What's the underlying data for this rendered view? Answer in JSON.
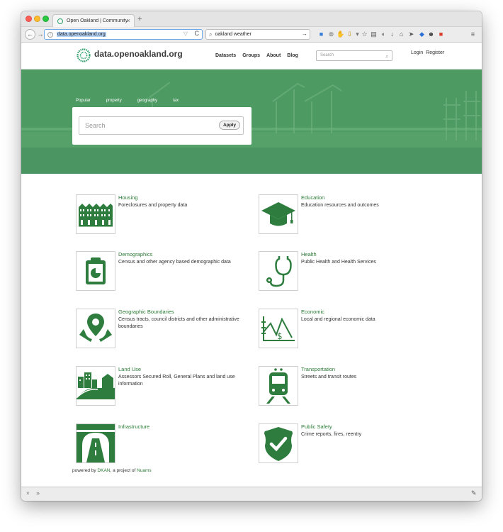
{
  "browser": {
    "tab_title": "Open Oakland | Community...",
    "tab_close": "×",
    "new_tab": "+",
    "back": "←",
    "forward": "→",
    "url": "data.openoakland.org",
    "info": "i",
    "url_dropdown": "▽",
    "reload": "C",
    "search_value": "oakland weather",
    "search_go": "→",
    "toolbar_icons": [
      {
        "name": "container-icon",
        "glyph": "■",
        "color": "#3a7cd6"
      },
      {
        "name": "extension-icon",
        "glyph": "⊜",
        "color": "#666666"
      },
      {
        "name": "hand-icon",
        "glyph": "✋",
        "color": "#3a7cd6"
      },
      {
        "name": "download-arrow-icon",
        "glyph": "⇩",
        "color": "#c08a00"
      },
      {
        "name": "dropdown-icon",
        "glyph": "▾",
        "color": "#777777"
      },
      {
        "name": "bookmark-star-icon",
        "glyph": "☆",
        "color": "#555555"
      },
      {
        "name": "clipboard-icon",
        "glyph": "▤",
        "color": "#555555"
      },
      {
        "name": "pocket-icon",
        "glyph": "◖",
        "color": "#555555"
      },
      {
        "name": "downloads-icon",
        "glyph": "↓",
        "color": "#555555"
      },
      {
        "name": "home-icon",
        "glyph": "⌂",
        "color": "#555555"
      },
      {
        "name": "send-icon",
        "glyph": "➤",
        "color": "#555555"
      },
      {
        "name": "drop-icon",
        "glyph": "◆",
        "color": "#2a6fd6"
      },
      {
        "name": "face-icon",
        "glyph": "☻",
        "color": "#444444"
      },
      {
        "name": "red-extension-icon",
        "glyph": "■",
        "color": "#d93a2b"
      },
      {
        "name": "menu-icon",
        "glyph": "≡",
        "color": "#444444"
      }
    ],
    "status_close": "×",
    "status_more": "»",
    "status_wrench": "✎"
  },
  "site": {
    "logo_text": "data.openoakland.org",
    "nav": [
      "Datasets",
      "Groups",
      "About",
      "Blog"
    ],
    "search_placeholder": "Search",
    "search_icon": "⌕",
    "login": "Login",
    "register": "Register"
  },
  "hero": {
    "tags": [
      "Popular",
      "property",
      "geography",
      "tax"
    ],
    "search_placeholder": "Search",
    "apply_label": "Apply"
  },
  "categories": [
    {
      "title": "Housing",
      "description": "Foreclosures and property data",
      "icon": "housing-icon"
    },
    {
      "title": "Education",
      "description": "Education resources and outcomes",
      "icon": "graduation-cap-icon"
    },
    {
      "title": "Demographics",
      "description": "Census and other agency based demographic data",
      "icon": "clipboard-chart-icon"
    },
    {
      "title": "Health",
      "description": "Public Health and Health Services",
      "icon": "stethoscope-icon"
    },
    {
      "title": "Geographic Boundaries",
      "description": "Census tracts, council districts and other administrative boundaries",
      "icon": "map-pin-icon"
    },
    {
      "title": "Economic",
      "description": "Local and regional economic data",
      "icon": "economic-chart-icon"
    },
    {
      "title": "Land Use",
      "description": "Assessors Secured Roll, General Plans and land use information",
      "icon": "land-use-icon"
    },
    {
      "title": "Transportation",
      "description": "Streets and transit routes",
      "icon": "train-icon"
    },
    {
      "title": "Infrastructure",
      "description": "",
      "icon": "road-tunnel-icon"
    },
    {
      "title": "Public Safety",
      "description": "Crime reports, fires, reentry",
      "icon": "shield-check-icon"
    }
  ],
  "footer": {
    "prefix": "powered by ",
    "dkan": "DKAN",
    "middle": ", a project of ",
    "nuams": "Nuams"
  },
  "colors": {
    "brand_green": "#2a7a35",
    "hero_green": "#4b9a62",
    "icon_green": "#2e7d3e"
  }
}
